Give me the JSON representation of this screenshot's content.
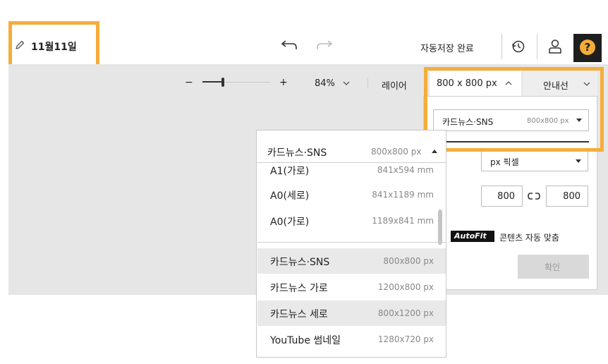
{
  "header": {
    "title": "11월11일",
    "autosave": "자동저장 완료",
    "help_icon_glyph": "?",
    "accent": "#f5ad3a"
  },
  "toolbar": {
    "zoom_minus": "−",
    "zoom_plus": "+",
    "zoom_percent": "84%",
    "zoom_fraction": 0.3,
    "layer_label": "레이어",
    "size_label": "800 x 800 px",
    "guide_label": "안내선"
  },
  "size_panel": {
    "preset_name": "카드뉴스·SNS",
    "preset_dim": "800x800 px",
    "unit_label": "px 픽셀",
    "width_value": "800",
    "height_value": "800",
    "autofit_logo": "AutoFit",
    "autofit_label": "콘텐츠 자동 맞춤",
    "confirm_label": "확인"
  },
  "dropdown": {
    "selected_name": "카드뉴스·SNS",
    "selected_dim": "800x800 px",
    "partial_name": "A1(가로)",
    "partial_dim": "841x594 mm",
    "items": [
      {
        "name": "A0(세로)",
        "dim": "841x1189 mm"
      },
      {
        "name": "A0(가로)",
        "dim": "1189x841 mm"
      },
      {
        "name": "카드뉴스·SNS",
        "dim": "800x800 px"
      },
      {
        "name": "카드뉴스 가로",
        "dim": "1200x800 px"
      },
      {
        "name": "카드뉴스 세로",
        "dim": "800x1200 px"
      },
      {
        "name": "YouTube 썸네일",
        "dim": "1280x720 px"
      }
    ]
  }
}
